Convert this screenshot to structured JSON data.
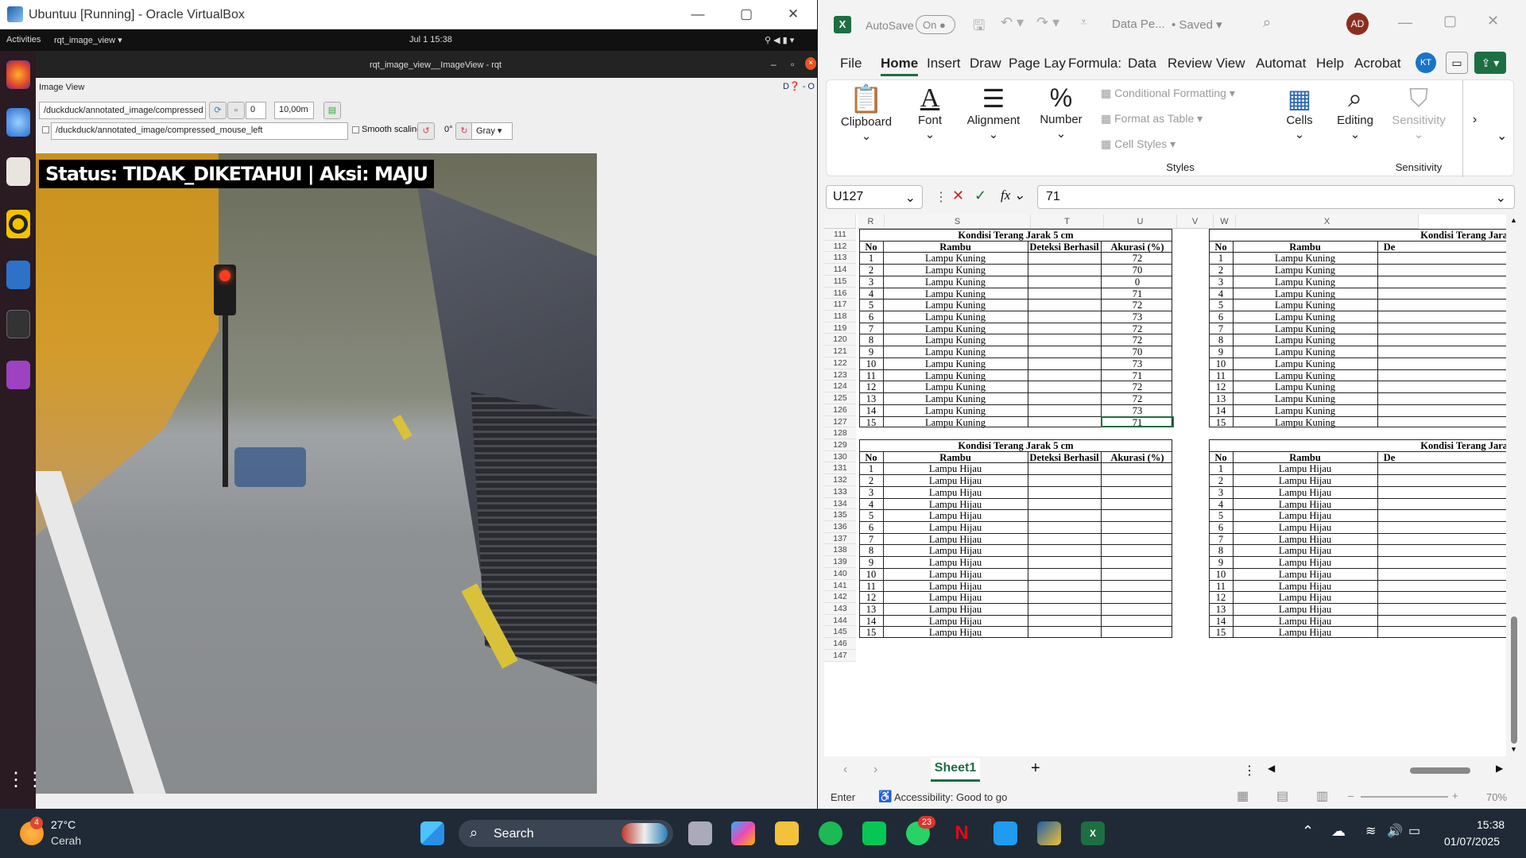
{
  "vbox": {
    "title": "Ubuntuu [Running] - Oracle VirtualBox",
    "minimize": "—",
    "maximize": "▢",
    "close": "✕"
  },
  "ubuntu": {
    "activities": "Activities",
    "app_menu": "rqt_image_view ▾",
    "clock": "Jul 1  15:38"
  },
  "rqt": {
    "window_title": "rqt_image_view__ImageView - rqt",
    "plugin_title": "Image View",
    "topic": "/duckduck/annotated_image/compressed",
    "spin_value": "0",
    "zoom_value": "10,00m",
    "publish_topic": "/duckduck/annotated_image/compressed_mouse_left",
    "smooth_label": "Smooth scaling",
    "rotation": "0°",
    "color_mode": "Gray",
    "overlay_text": "Status: TIDAK_DIKETAHUI | Aksi: MAJU"
  },
  "excel": {
    "autosave_label": "AutoSave",
    "autosave_state": "On",
    "filename": "Data Pe...",
    "saved": "• Saved ▾",
    "avatar": "AD",
    "menu": [
      "File",
      "Home",
      "Insert",
      "Draw",
      "Page Lay",
      "Formula:",
      "Data",
      "Review",
      "View",
      "Automat",
      "Help",
      "Acrobat"
    ],
    "ribbon": {
      "clipboard": "Clipboard",
      "font": "Font",
      "alignment": "Alignment",
      "number": "Number",
      "conditional": "Conditional Formatting ▾",
      "format_table": "Format as Table ▾",
      "cell_styles": "Cell Styles ▾",
      "styles_group": "Styles",
      "cells": "Cells",
      "editing": "Editing",
      "sensitivity": "Sensitivity",
      "sensitivity_group": "Sensitivity"
    },
    "name_box": "U127",
    "formula_value": "71",
    "columns": [
      "R",
      "S",
      "T",
      "U",
      "V",
      "W",
      "X"
    ],
    "table1_title": "Kondisi Terang Jarak 5 cm",
    "table2_title": "Kondisi Terang Jarak 5 cm",
    "table_right_title": "Kondisi Terang Jara",
    "headers": [
      "No",
      "Rambu",
      "Deteksi Berhasil",
      "Akurasi (%)"
    ],
    "right_headers": [
      "No",
      "Rambu",
      "De"
    ],
    "rows_top_start": 111,
    "yellow_label": "Lampu Kuning",
    "green_label": "Lampu Hijau",
    "accuracy_yellow": [
      "72",
      "70",
      "0",
      "71",
      "72",
      "73",
      "72",
      "72",
      "70",
      "73",
      "71",
      "72",
      "72",
      "73",
      "71"
    ],
    "sheet_tab": "Sheet1",
    "status_mode": "Enter",
    "accessibility": "Accessibility: Good to go",
    "zoom": "70%"
  },
  "taskbar": {
    "weather_temp": "27°C",
    "weather_desc": "Cerah",
    "weather_badge": "4",
    "search": "Search",
    "whatsapp_badge": "23",
    "time": "15:38",
    "date": "01/07/2025"
  }
}
